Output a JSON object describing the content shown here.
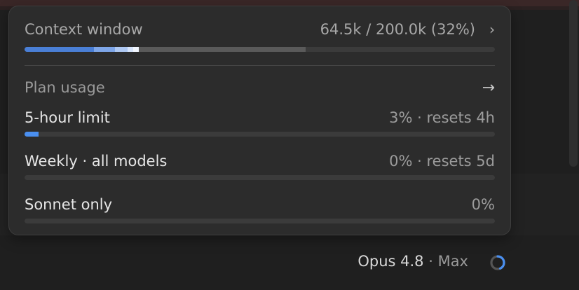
{
  "context": {
    "title": "Context window",
    "usage": "64.5k / 200.0k (32%)",
    "used_fraction": 0.32
  },
  "plan": {
    "title": "Plan usage",
    "limits": [
      {
        "label": "5-hour limit",
        "value": "3% · resets 4h",
        "percent": 3
      },
      {
        "label": "Weekly · all models",
        "value": "0% · resets 5d",
        "percent": 0
      },
      {
        "label": "Sonnet only",
        "value": "0%",
        "percent": 0
      }
    ]
  },
  "footer": {
    "model": "Opus 4.8",
    "plan": " · Max"
  },
  "colors": {
    "accent": "#4a8ff0",
    "bar_track": "#3b3b3b"
  },
  "icons": {
    "chevron": "chevron-right-icon",
    "arrow": "arrow-right-icon",
    "spinner": "loading-spinner-icon"
  }
}
